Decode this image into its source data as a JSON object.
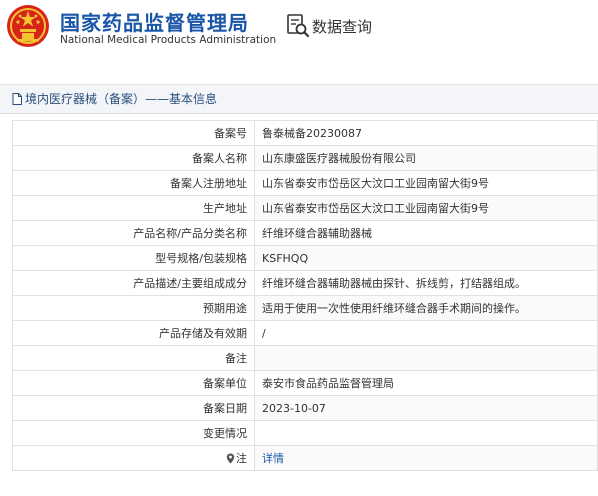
{
  "header": {
    "title_cn": "国家药品监督管理局",
    "title_en": "National Medical Products Administration",
    "query_title": "数据查询",
    "brand_color": "#1a56a8",
    "emblem_color": "#d7241a",
    "query_icon": "magnifier-document-icon"
  },
  "section": {
    "title": "境内医疗器械（备案）——基本信息",
    "icon": "document-icon"
  },
  "rows": [
    {
      "label": "备案号",
      "value": "鲁泰械备20230087"
    },
    {
      "label": "备案人名称",
      "value": "山东康盛医疗器械股份有限公司"
    },
    {
      "label": "备案人注册地址",
      "value": "山东省泰安市岱岳区大汶口工业园南留大街9号"
    },
    {
      "label": "生产地址",
      "value": "山东省泰安市岱岳区大汶口工业园南留大街9号"
    },
    {
      "label": "产品名称/产品分类名称",
      "value": "纤维环缝合器辅助器械"
    },
    {
      "label": "型号规格/包装规格",
      "value": "KSFHQQ"
    },
    {
      "label": "产品描述/主要组成成分",
      "value": "纤维环缝合器辅助器械由探针、拆线剪，打结器组成。"
    },
    {
      "label": "预期用途",
      "value": "适用于使用一次性使用纤维环缝合器手术期间的操作。"
    },
    {
      "label": "产品存储及有效期",
      "value": "/"
    },
    {
      "label": "备注",
      "value": ""
    },
    {
      "label": "备案单位",
      "value": "泰安市食品药品监督管理局"
    },
    {
      "label": "备案日期",
      "value": "2023-10-07"
    },
    {
      "label": "变更情况",
      "value": ""
    }
  ],
  "footer_row": {
    "label": "注",
    "link": "详情",
    "icon": "location-pin-icon"
  }
}
